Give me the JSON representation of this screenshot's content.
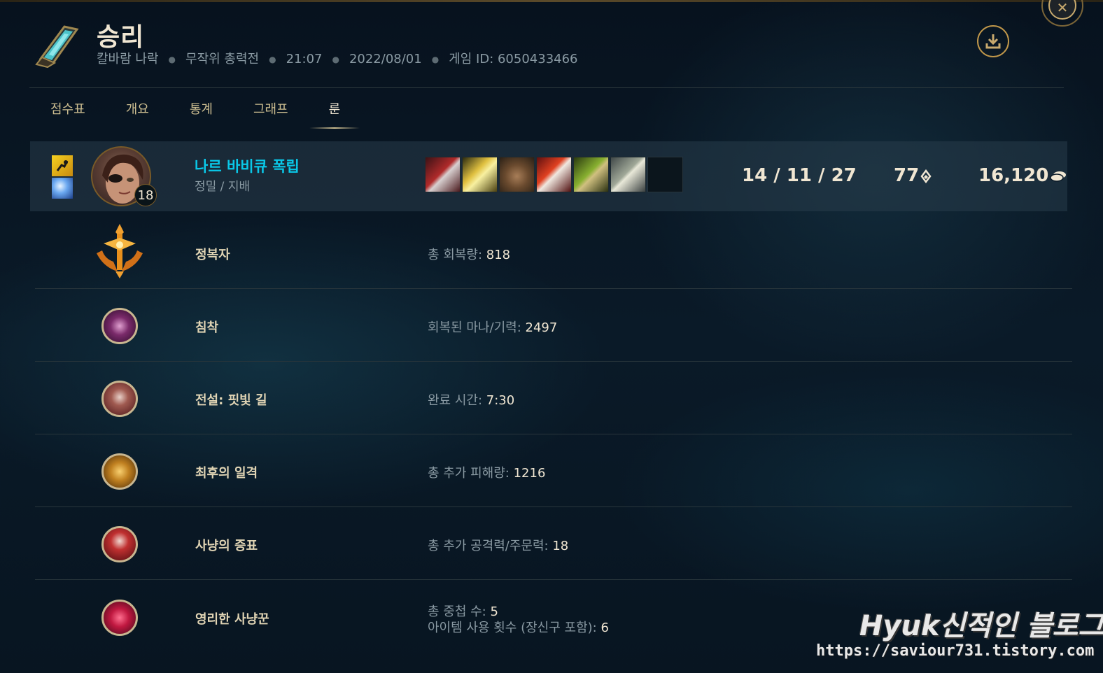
{
  "header": {
    "title": "승리",
    "map": "칼바람 나락",
    "mode": "무작위 총력전",
    "duration": "21:07",
    "date": "2022/08/01",
    "game_id": "게임 ID: 6050433466"
  },
  "tabs": [
    {
      "label": "점수표"
    },
    {
      "label": "개요"
    },
    {
      "label": "통계"
    },
    {
      "label": "그래프"
    },
    {
      "label": "룬",
      "active": true
    }
  ],
  "player": {
    "name": "나르 바비큐 폭립",
    "position": "정밀 / 지배",
    "level": "18",
    "kda": "14 / 11 / 27",
    "cs": "77",
    "gold": "16,120",
    "spells": [
      "ghost-spell-icon",
      "snowball-spell-icon"
    ],
    "items": [
      "item-1-icon",
      "item-2-icon",
      "boots-icon",
      "item-4-icon",
      "item-5-icon",
      "item-6-icon",
      "empty-slot"
    ]
  },
  "runes": [
    {
      "name": "정복자",
      "stat_label": "총 회복량: ",
      "stat_value": "818"
    },
    {
      "name": "침착",
      "stat_label": "회복된 마나/기력: ",
      "stat_value": "2497"
    },
    {
      "name": "전설: 핏빛 길",
      "stat_label": "완료 시간: ",
      "stat_value": "7:30"
    },
    {
      "name": "최후의 일격",
      "stat_label": "총 추가 피해량: ",
      "stat_value": "1216"
    },
    {
      "name": "사냥의 증표",
      "stat_label": "총 추가 공격력/주문력: ",
      "stat_value": "18"
    },
    {
      "name": "영리한 사냥꾼",
      "stat_label": "총 중첩 수: ",
      "stat_value": "5",
      "stat2_label": "아이템 사용 횟수 (장신구 포함): ",
      "stat2_value": "6"
    }
  ],
  "watermark": {
    "title": "Hyuk신적인 블로그",
    "url": "https://saviour731.tistory.com"
  },
  "colors": {
    "accent_gold": "#c8aa6e",
    "player_name": "#0ac8e8",
    "background": "#0a1a28"
  }
}
